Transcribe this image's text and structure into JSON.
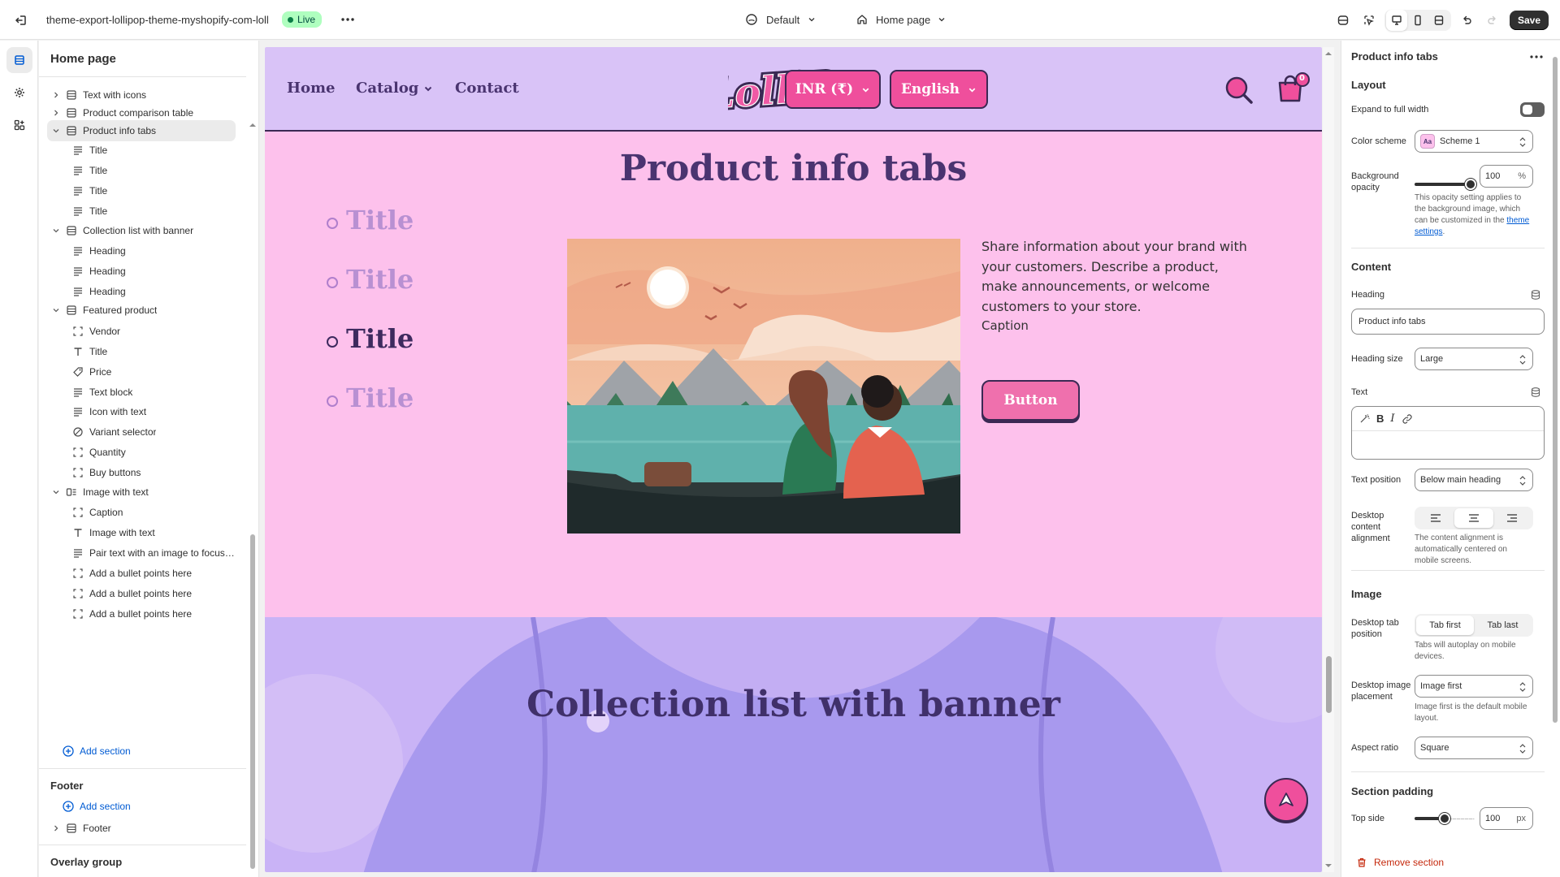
{
  "topbar": {
    "store_name": "theme-export-lollipop-theme-myshopify-com-loll",
    "live_badge": "Live",
    "theme_select": "Default",
    "page_select": "Home page",
    "save_label": "Save"
  },
  "sidebar": {
    "title": "Home page",
    "tree": [
      {
        "label": "Text with icons",
        "level": 0,
        "icon": "section-icon",
        "chevron": "right"
      },
      {
        "label": "Product comparison table",
        "level": 0,
        "icon": "section-icon",
        "chevron": "right"
      },
      {
        "label": "Product info tabs",
        "level": 0,
        "icon": "section-icon",
        "chevron": "down",
        "selected": true
      },
      {
        "label": "Title",
        "level": 1,
        "icon": "text-lines-icon"
      },
      {
        "label": "Title",
        "level": 1,
        "icon": "text-lines-icon"
      },
      {
        "label": "Title",
        "level": 1,
        "icon": "text-lines-icon"
      },
      {
        "label": "Title",
        "level": 1,
        "icon": "text-lines-icon"
      },
      {
        "label": "Collection list with banner",
        "level": 0,
        "icon": "section-icon",
        "chevron": "down"
      },
      {
        "label": "Heading",
        "level": 1,
        "icon": "text-lines-icon"
      },
      {
        "label": "Heading",
        "level": 1,
        "icon": "text-lines-icon"
      },
      {
        "label": "Heading",
        "level": 1,
        "icon": "text-lines-icon"
      },
      {
        "label": "Featured product",
        "level": 0,
        "icon": "section-icon",
        "chevron": "down"
      },
      {
        "label": "Vendor",
        "level": 1,
        "icon": "block-icon"
      },
      {
        "label": "Title",
        "level": 1,
        "icon": "text-t-icon"
      },
      {
        "label": "Price",
        "level": 1,
        "icon": "price-tag-icon"
      },
      {
        "label": "Text block",
        "level": 1,
        "icon": "text-lines-icon"
      },
      {
        "label": "Icon with text",
        "level": 1,
        "icon": "text-lines-icon"
      },
      {
        "label": "Variant selector",
        "level": 1,
        "icon": "variant-icon"
      },
      {
        "label": "Quantity",
        "level": 1,
        "icon": "block-icon"
      },
      {
        "label": "Buy buttons",
        "level": 1,
        "icon": "block-icon"
      },
      {
        "label": "Image with text",
        "level": 0,
        "icon": "image-text-icon",
        "chevron": "down"
      },
      {
        "label": "Caption",
        "level": 1,
        "icon": "block-icon"
      },
      {
        "label": "Image with text",
        "level": 1,
        "icon": "text-t-icon"
      },
      {
        "label": "Pair text with an image to focus ...",
        "level": 1,
        "icon": "text-lines-icon"
      },
      {
        "label": "Add a bullet points here",
        "level": 1,
        "icon": "block-icon"
      },
      {
        "label": "Add a bullet points here",
        "level": 1,
        "icon": "block-icon"
      },
      {
        "label": "Add a bullet points here",
        "level": 1,
        "icon": "block-icon"
      }
    ],
    "add_section": "Add section",
    "footer_title": "Footer",
    "footer_add_section": "Add section",
    "footer_item": "Footer",
    "overlay_title": "Overlay group"
  },
  "store": {
    "nav": [
      "Home",
      "Catalog",
      "Contact"
    ],
    "logo_text": "LolliPop",
    "currency": "INR (₹)",
    "language": "English",
    "cart_count": "0"
  },
  "product_info_tabs": {
    "heading": "Product info tabs",
    "tabs": [
      "Title",
      "Title",
      "Title",
      "Title"
    ],
    "active_tab": 2,
    "text": "Share information about your brand with your customers. Describe a product, make announcements, or welcome customers to your store.",
    "caption": "Caption",
    "button": "Button"
  },
  "collection_banner": {
    "heading": "Collection list with banner"
  },
  "settings": {
    "title": "Product info tabs",
    "layout_title": "Layout",
    "expand_label": "Expand to full width",
    "color_scheme_label": "Color scheme",
    "color_scheme_value": "Scheme 1",
    "bg_opacity_label": "Background opacity",
    "bg_opacity_value": "100",
    "bg_opacity_unit": "%",
    "bg_opacity_help": "This opacity setting applies to the background image, which can be customized in the",
    "bg_opacity_link": "theme settings",
    "content_title": "Content",
    "heading_label": "Heading",
    "heading_value": "Product info tabs",
    "heading_size_label": "Heading size",
    "heading_size_value": "Large",
    "text_label": "Text",
    "text_position_label": "Text position",
    "text_position_value": "Below main heading",
    "desktop_alignment_label": "Desktop content alignment",
    "alignment_help": "The content alignment is automatically centered on mobile screens.",
    "image_title": "Image",
    "tab_position_label": "Desktop tab position",
    "tab_first": "Tab first",
    "tab_last": "Tab last",
    "tab_help": "Tabs will autoplay on mobile devices.",
    "image_placement_label": "Desktop image placement",
    "image_placement_value": "Image first",
    "image_placement_help": "Image first is the default mobile layout.",
    "aspect_ratio_label": "Aspect ratio",
    "aspect_ratio_value": "Square",
    "padding_title": "Section padding",
    "top_side_label": "Top side",
    "top_side_value": "100",
    "top_side_unit": "px",
    "remove_label": "Remove section"
  },
  "colors": {
    "accent_pink": "#ef4f9c",
    "header_lilac": "#d9c3f7",
    "section_pink": "#fdc1ec",
    "heading_purple": "#4a3470"
  }
}
